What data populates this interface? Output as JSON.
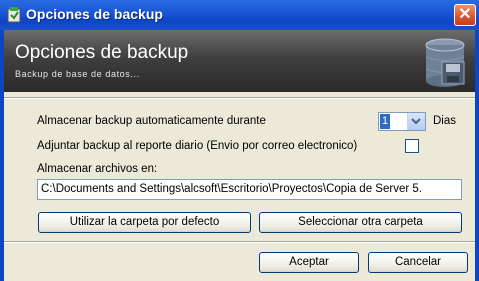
{
  "window": {
    "title": "Opciones de backup",
    "close_glyph": "✕"
  },
  "banner": {
    "title": "Opciones de backup",
    "subtitle": "Backup de base de datos...",
    "icon": "database-icon"
  },
  "options": {
    "auto_backup_label": "Almacenar backup automaticamente durante",
    "days_value": "1",
    "days_unit": "Dias",
    "attach_report_label": "Adjuntar backup al reporte diario (Envio por correo electronico)",
    "attach_report_checked": false,
    "store_files_label": "Almacenar archivos en:",
    "path_value": "C:\\Documents and Settings\\alcsoft\\Escritorio\\Proyectos\\Copia de Server 5."
  },
  "buttons": {
    "default_folder": "Utilizar la carpeta por defecto",
    "select_folder": "Seleccionar otra carpeta",
    "accept": "Aceptar",
    "cancel": "Cancelar"
  },
  "colors": {
    "titlebar": "#1a57d6",
    "banner": "#3f3f3f",
    "dialog_bg": "#ece9d8",
    "close_button": "#d9542b"
  }
}
